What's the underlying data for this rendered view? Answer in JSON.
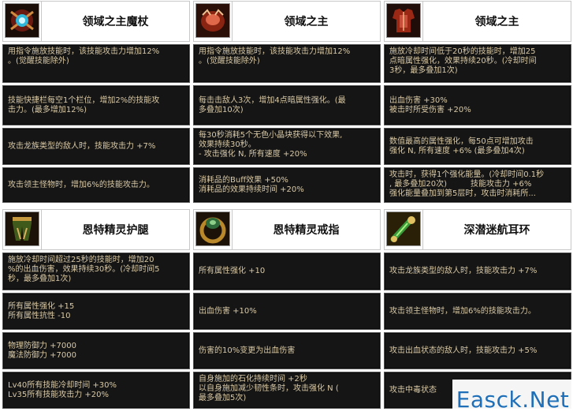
{
  "items": [
    {
      "title": "领域之主魔杖",
      "icon": "staff-icon",
      "stats": [
        "用指令施放技能时，该技能攻击力增加12%\n。(觉醒技能除外)",
        "技能快捷栏每空1个栏位，增加2%的技能攻\n击力。(最多增加12%)",
        "攻击龙族类型的敌人时，技能攻击力 +7%",
        "攻击领主怪物时，增加6%的技能攻击力。"
      ]
    },
    {
      "title": "领域之主",
      "icon": "shoulder-armor-icon",
      "stats": [
        "用指令施放技能时，该技能攻击力增加12%\n。(觉醒技能除外)",
        "每击击敌人3次，增加4点暗属性强化。(最\n多叠加10次)",
        "每30秒消耗5个无色小晶块获得以下效果,\n效果持续30秒。\n- 攻击强化 N, 所有速度 +20%",
        "消耗品的Buff效果 +50%\n消耗品的效果持续时间 +20%"
      ]
    },
    {
      "title": "领域之主",
      "icon": "chest-armor-icon",
      "stats": [
        "施放冷却时间低于20秒的技能时，增加25\n点暗属性强化，效果持续20秒。(冷却时间\n3秒，最多叠加1次)",
        "出血伤害 +30%\n被击时所受伤害 +20%",
        "数值最高的属性强化，每50点可增加攻击\n强化 N, 所有速度 +6% (最多叠加4次)",
        "攻击时，获得1个强化能量。(冷却时间0.1秒\n, 最多叠加20次)　　　技能攻击力 +6%\n强化能量叠加到第5层时，攻击时消耗所..."
      ]
    },
    {
      "title": "恩特精灵护腿",
      "icon": "leg-armor-icon",
      "stats": [
        "施放冷却时间超过25秒的技能时，增加20\n%的出血伤害，效果持续30秒。(冷却时间5\n秒，最多叠加1次)",
        "所有属性强化 +15\n所有属性抗性 -10",
        "物理防御力 +7000\n魔法防御力 +7000",
        "Lv40所有技能冷却时间 +30%\nLv35所有技能攻击力 +20%"
      ]
    },
    {
      "title": "恩特精灵戒指",
      "icon": "ring-icon",
      "stats": [
        "所有属性强化 +10",
        "出血伤害 +10%",
        "伤害的10%变更为出血伤害",
        "自身施加的石化持续时间 +2秒\n以自身施加减少韧性条时，攻击强化 N (\n最多叠加5次)"
      ]
    },
    {
      "title": "深潜迷航耳环",
      "icon": "earring-icon",
      "stats": [
        "攻击龙族类型的敌人时，技能攻击力 +7%",
        "攻击领主怪物时，增加6%的技能攻击力。",
        "攻击出血状态的敌人时，技能攻击力 +5%",
        "攻击中毒状态"
      ]
    }
  ],
  "watermark": "Easck.Net"
}
